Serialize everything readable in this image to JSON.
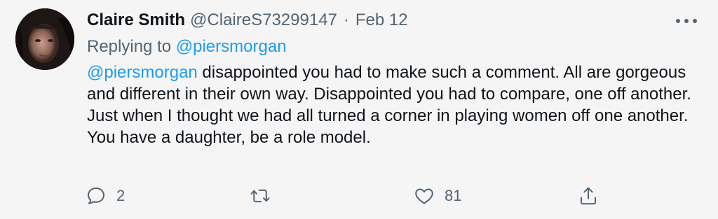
{
  "tweet": {
    "author_name": "Claire Smith",
    "author_handle": "@ClaireS73299147",
    "separator": "·",
    "date": "Feb 12",
    "replying_prefix": "Replying to",
    "replying_to": "@piersmorgan",
    "body_mention": "@piersmorgan",
    "body_text": " disappointed you had to make such a comment. All are gorgeous and different in their own way. Disappointed you had to compare, one off another. Just when I thought we had all turned a corner in playing women off one another. You have a daughter, be a role model."
  },
  "actions": {
    "reply_icon": "reply-icon",
    "reply_count": "2",
    "retweet_icon": "retweet-icon",
    "retweet_count": "",
    "like_icon": "heart-icon",
    "like_count": "81",
    "share_icon": "share-icon"
  },
  "colors": {
    "background": "#f5f5f5",
    "text": "#0f1419",
    "muted": "#536471",
    "link": "#1d9bf0"
  }
}
